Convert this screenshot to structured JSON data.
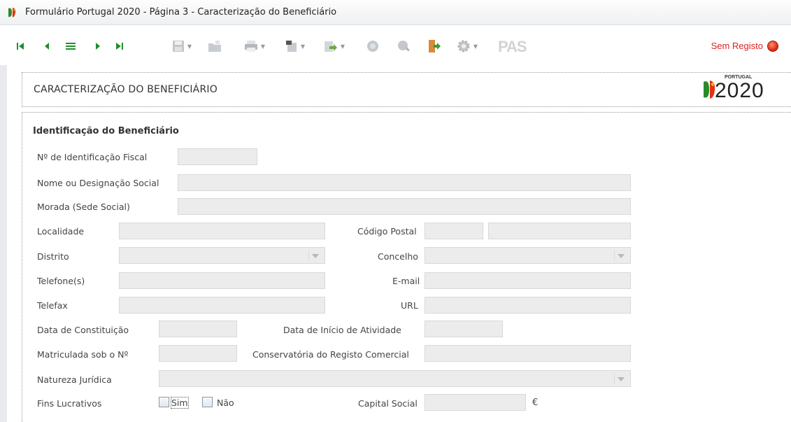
{
  "window": {
    "title": "Formulário Portugal 2020 - Página 3 - Caracterização do Beneficiário"
  },
  "toolbar": {
    "status_text": "Sem Registo",
    "status_color": "#e0301a",
    "nav_icons": [
      "first-icon",
      "prev-icon",
      "list-icon",
      "next-icon",
      "last-icon"
    ],
    "action_icons": [
      "save-icon",
      "folder-icon",
      "print-icon",
      "export-icon",
      "import-icon",
      "validate-icon",
      "search-icon",
      "exit-icon",
      "settings-icon",
      "pas-icon"
    ]
  },
  "header": {
    "title": "CARACTERIZAÇÃO DO BENEFICIÁRIO",
    "logo_small": "PORTUGAL",
    "logo_year": "2020"
  },
  "form": {
    "section_title": "Identificação do Beneficiário",
    "labels": {
      "nif": "Nº de Identificação Fiscal",
      "nome": "Nome ou Designação Social",
      "morada": "Morada (Sede Social)",
      "localidade": "Localidade",
      "codigo_postal": "Código Postal",
      "distrito": "Distrito",
      "concelho": "Concelho",
      "telefone": "Telefone(s)",
      "email": "E-mail",
      "telefax": "Telefax",
      "url": "URL",
      "data_constituicao": "Data de Constituição",
      "data_inicio": "Data de Início de Atividade",
      "matriculada": "Matriculada sob o Nº",
      "conservatoria": "Conservatória do Registo Comercial",
      "natureza": "Natureza Jurídica",
      "fins_lucrativos": "Fins Lucrativos",
      "sim": "Sim",
      "nao": "Não",
      "capital_social": "Capital Social",
      "currency": "€"
    },
    "values": {
      "nif": "",
      "nome": "",
      "morada": "",
      "localidade": "",
      "codigo_postal_1": "",
      "codigo_postal_2": "",
      "distrito": "",
      "concelho": "",
      "telefone": "",
      "email": "",
      "telefax": "",
      "url": "",
      "data_constituicao": "",
      "data_inicio": "",
      "matriculada": "",
      "conservatoria": "",
      "natureza": "",
      "capital_social": "",
      "sim_checked": false,
      "nao_checked": false
    }
  }
}
